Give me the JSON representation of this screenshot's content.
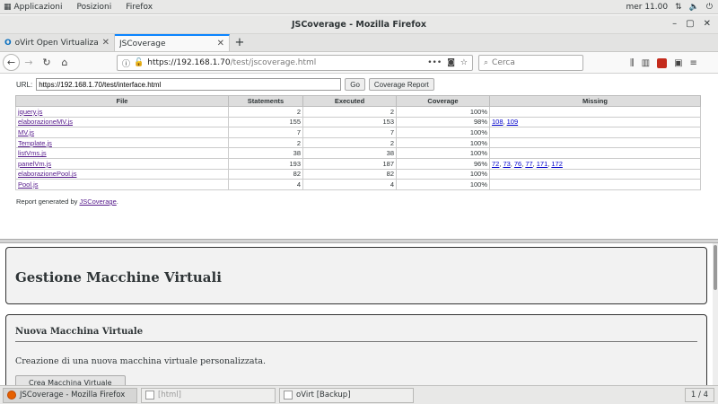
{
  "topbar": {
    "applications": "Applicazioni",
    "places": "Posizioni",
    "firefox": "Firefox",
    "clock": "mer 11.00"
  },
  "window": {
    "title": "JSCoverage - Mozilla Firefox"
  },
  "tabs": [
    {
      "label": "oVirt Open Virtualization M"
    },
    {
      "label": "JSCoverage"
    }
  ],
  "navbar": {
    "url_host": "https://192.168.1.70",
    "url_path": "/test/jscoverage.html",
    "search_placeholder": "Cerca"
  },
  "coverage": {
    "url_label": "URL:",
    "url_value": "https://192.168.1.70/test/interface.html",
    "go_label": "Go",
    "report_button": "Coverage Report",
    "headers": [
      "File",
      "Statements",
      "Executed",
      "Coverage",
      "Missing"
    ],
    "rows": [
      {
        "file": "jquery.js",
        "statements": "2",
        "executed": "2",
        "coverage": "100%",
        "missing": []
      },
      {
        "file": "elaborazioneMV.js",
        "statements": "155",
        "executed": "153",
        "coverage": "98%",
        "missing": [
          "108",
          "109"
        ]
      },
      {
        "file": "MV.js",
        "statements": "7",
        "executed": "7",
        "coverage": "100%",
        "missing": []
      },
      {
        "file": "Template.js",
        "statements": "2",
        "executed": "2",
        "coverage": "100%",
        "missing": []
      },
      {
        "file": "listVms.js",
        "statements": "38",
        "executed": "38",
        "coverage": "100%",
        "missing": []
      },
      {
        "file": "panelVm.js",
        "statements": "193",
        "executed": "187",
        "coverage": "96%",
        "missing": [
          "72",
          "73",
          "76",
          "77",
          "171",
          "172"
        ]
      },
      {
        "file": "elaborazionePool.js",
        "statements": "82",
        "executed": "82",
        "coverage": "100%",
        "missing": []
      },
      {
        "file": "Pool.js",
        "statements": "4",
        "executed": "4",
        "coverage": "100%",
        "missing": []
      }
    ],
    "report_prefix": "Report generated by ",
    "report_link": "JSCoverage",
    "report_suffix": "."
  },
  "app": {
    "heading": "Gestione Macchine Virtuali",
    "section_title": "Nuova Macchina Virtuale",
    "section_desc": "Creazione di una nuova macchina virtuale personalizzata.",
    "create_button": "Crea Macchina Virtuale"
  },
  "taskbar": {
    "items": [
      {
        "label": "JSCoverage - Mozilla Firefox"
      },
      {
        "label": "[html]"
      },
      {
        "label": "oVirt [Backup]"
      }
    ],
    "workspace": "1 / 4"
  }
}
